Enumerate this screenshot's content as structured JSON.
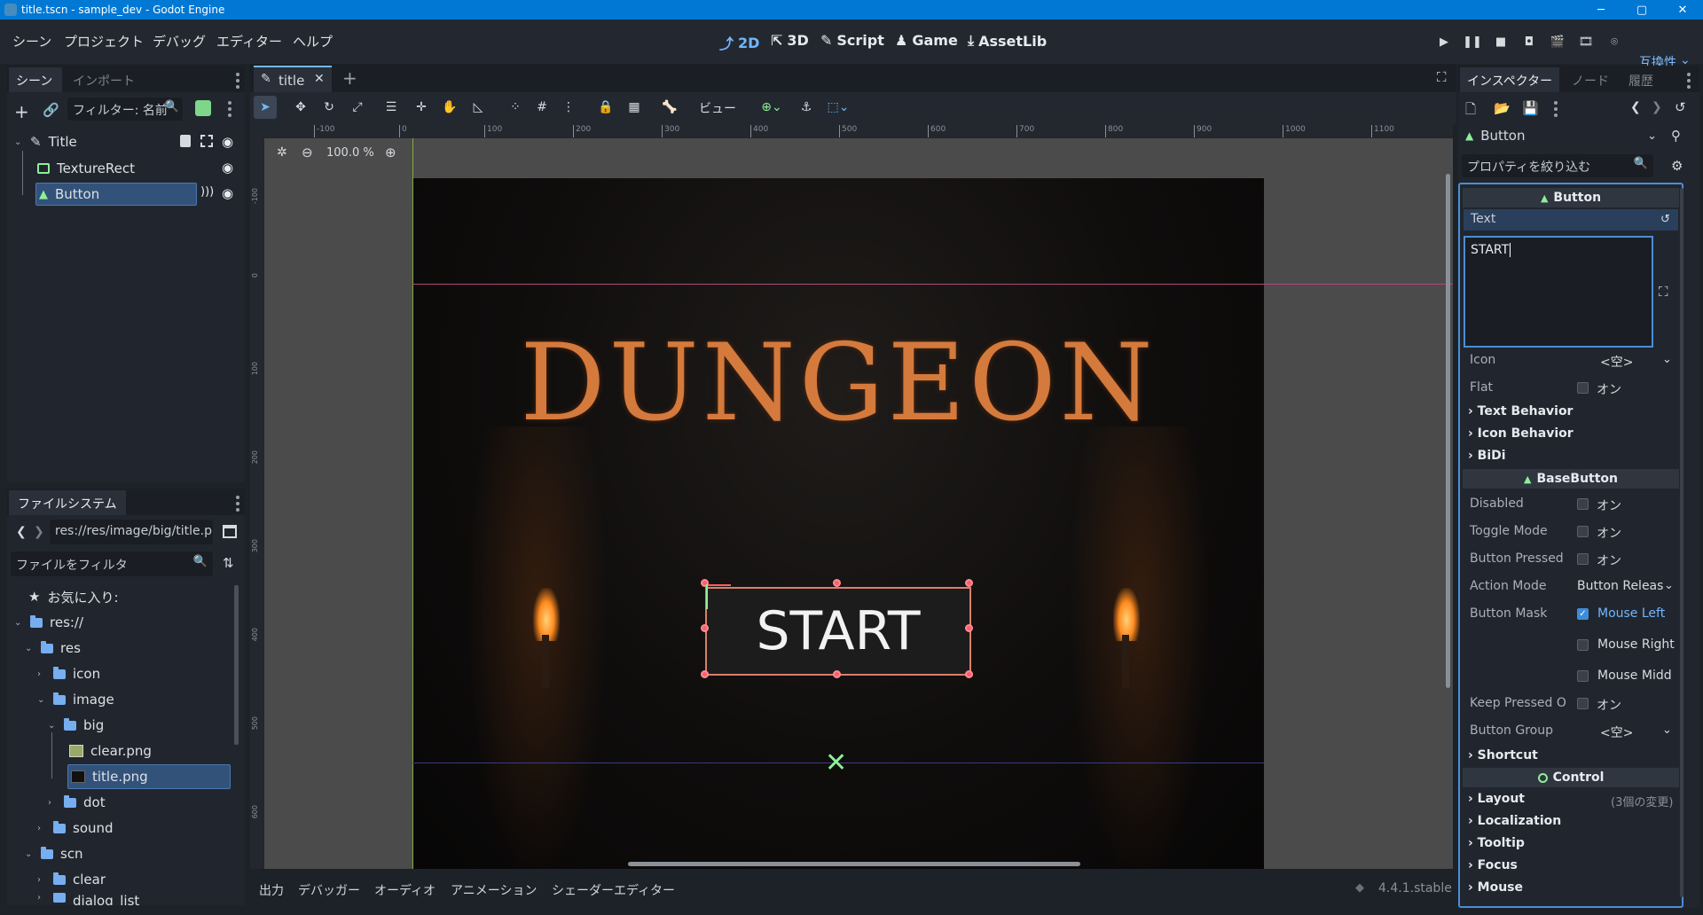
{
  "window": {
    "title": "title.tscn - sample_dev - Godot Engine",
    "controls": [
      "─",
      "▢",
      "✕"
    ]
  },
  "menu": [
    "シーン",
    "プロジェクト",
    "デバッグ",
    "エディター",
    "ヘルプ"
  ],
  "workspaces": [
    "2D",
    "3D",
    "Script",
    "Game",
    "AssetLib"
  ],
  "renderer": "互換性",
  "scene_dock": {
    "tabs": [
      "シーン",
      "インポート"
    ],
    "filter_placeholder": "フィルター: 名前",
    "nodes": [
      "Title",
      "TextureRect",
      "Button"
    ]
  },
  "filesystem": {
    "tab": "ファイルシステム",
    "path": "res://res/image/big/title.p",
    "filter_placeholder": "ファイルをフィルタ",
    "favorites": "お気に入り:",
    "items": [
      "res://",
      "res",
      "icon",
      "image",
      "big",
      "clear.png",
      "title.png",
      "dot",
      "sound",
      "scn",
      "clear",
      "dialog_list"
    ]
  },
  "editor": {
    "tab": "title",
    "view_menu": "ビュー",
    "zoom": "100.0 %",
    "ruler_labels": [
      "-100",
      "0",
      "100",
      "200",
      "300",
      "400",
      "500",
      "600",
      "700",
      "800",
      "900",
      "1000",
      "1100"
    ],
    "vruler_labels": [
      "-100",
      "0",
      "100",
      "200",
      "300",
      "400",
      "500",
      "600"
    ],
    "game_title": "DUNGEON",
    "button_text": "START"
  },
  "bottom_panel": {
    "tabs": [
      "出力",
      "デバッガー",
      "オーディオ",
      "アニメーション",
      "シェーダーエディター"
    ],
    "version": "4.4.1.stable"
  },
  "inspector": {
    "tabs": [
      "インスペクター",
      "ノード",
      "履歴"
    ],
    "node_type": "Button",
    "filter_placeholder": "プロパティを絞り込む",
    "section_button": "Button",
    "text_label": "Text",
    "text_value": "START",
    "icon_label": "Icon",
    "icon_value": "<空>",
    "flat_label": "Flat",
    "on_label": "オン",
    "text_behavior": "Text Behavior",
    "icon_behavior": "Icon Behavior",
    "bidi": "BiDi",
    "section_basebutton": "BaseButton",
    "disabled": "Disabled",
    "toggle_mode": "Toggle Mode",
    "button_pressed": "Button Pressed",
    "action_mode": "Action Mode",
    "action_mode_value": "Button Releas",
    "button_mask": "Button Mask",
    "mask_left": "Mouse Left",
    "mask_right": "Mouse Right",
    "mask_middle": "Mouse Midd",
    "keep_pressed": "Keep Pressed O",
    "button_group": "Button Group",
    "button_group_value": "<空>",
    "shortcut": "Shortcut",
    "section_control": "Control",
    "layout": "Layout",
    "layout_changes": "(3個の変更)",
    "localization": "Localization",
    "tooltip": "Tooltip",
    "focus": "Focus",
    "mouse": "Mouse"
  },
  "colors": {
    "accent": "#70b6ff",
    "titlebar": "#0078d4",
    "node_green": "#8eef97",
    "selection": "#ff5d6a"
  }
}
